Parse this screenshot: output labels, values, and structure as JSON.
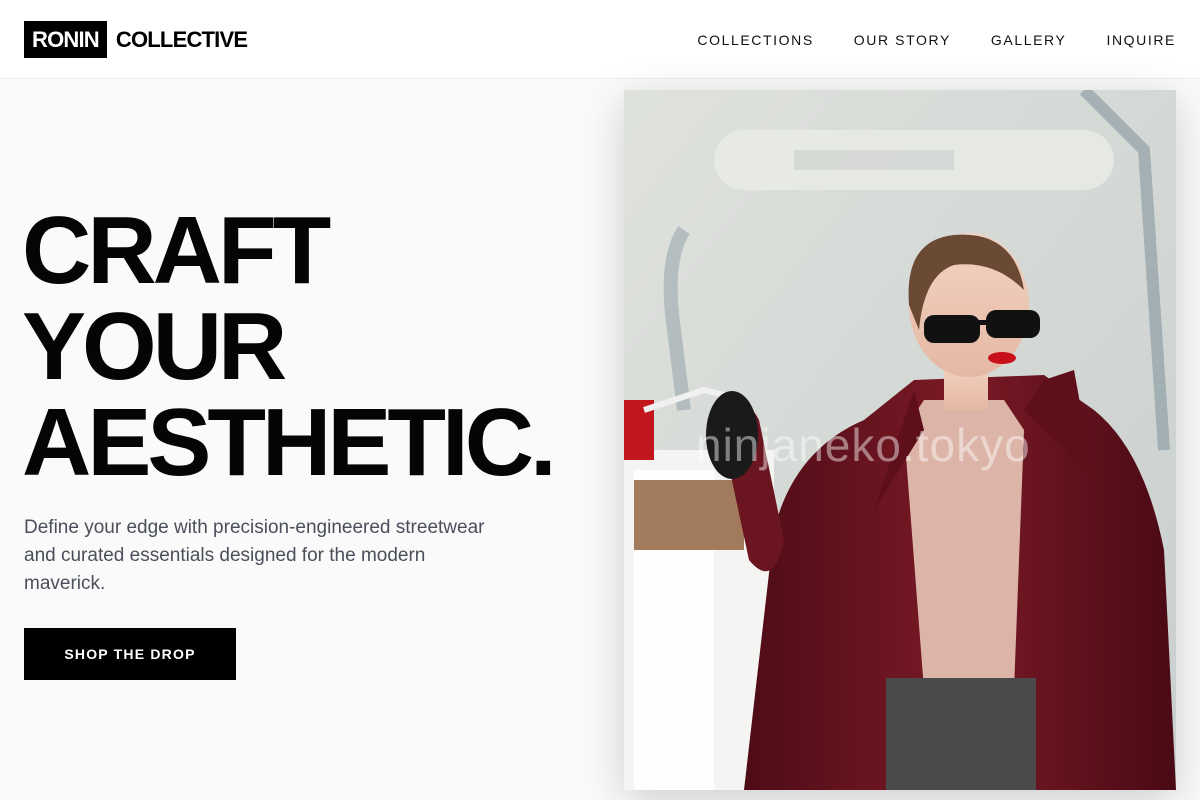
{
  "brand": {
    "box_text": "RONIN",
    "text": "COLLECTIVE"
  },
  "nav": {
    "items": [
      {
        "label": "COLLECTIONS"
      },
      {
        "label": "OUR STORY"
      },
      {
        "label": "GALLERY"
      },
      {
        "label": "INQUIRE"
      }
    ]
  },
  "hero": {
    "headline_lines": [
      "CRAFT",
      "YOUR",
      "AESTHETIC."
    ],
    "subtext": "Define your edge with precision-engineered streetwear and curated essentials designed for the modern maverick.",
    "cta_label": "SHOP THE DROP",
    "image": {
      "subject": "woman in burgundy coat and sunglasses carrying shopping bags",
      "watermark": "ninjaneko.tokyo"
    }
  },
  "colors": {
    "accent": "#000000",
    "background": "#fafafa",
    "subtext": "#4a4f5a",
    "coat": "#6e1420"
  }
}
